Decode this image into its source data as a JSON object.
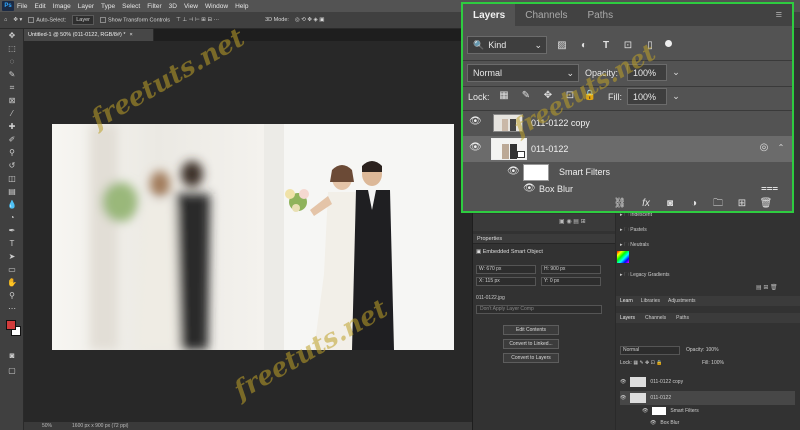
{
  "menubar": {
    "logo": "Ps",
    "items": [
      "File",
      "Edit",
      "Image",
      "Layer",
      "Type",
      "Select",
      "Filter",
      "3D",
      "View",
      "Window",
      "Help"
    ]
  },
  "options": {
    "auto_select": "Auto-Select:",
    "target": "Layer",
    "transform": "Show Transform Controls",
    "mode3d": "3D Mode:"
  },
  "document": {
    "tab_title": "Untitled-1 @ 50% (011-0122, RGB/8#) *",
    "zoom": "50%",
    "size": "1600 px x 900 px (72 ppi)"
  },
  "watermark": "freetuts.net",
  "layers_panel": {
    "tabs": [
      "Layers",
      "Channels",
      "Paths"
    ],
    "filter": "Kind",
    "blend": "Normal",
    "opacity_label": "Opacity:",
    "opacity": "100%",
    "lock_label": "Lock:",
    "fill_label": "Fill:",
    "fill": "100%",
    "layers": [
      {
        "name": "011-0122 copy"
      },
      {
        "name": "011-0122"
      }
    ],
    "smart_filters": "Smart Filters",
    "box_blur": "Box Blur"
  },
  "properties": {
    "title": "Properties",
    "type": "Embedded Smart Object",
    "w_label": "W:",
    "w": "670 px",
    "h_label": "H:",
    "h": "900 px",
    "x_label": "X:",
    "x": "115 px",
    "y_label": "Y:",
    "y": "0 px",
    "file": "011-0122.jpg",
    "layer_comp": "Don't Apply Layer Comp",
    "edit_contents": "Edit Contents",
    "convert_linked": "Convert to Linked...",
    "convert_layers": "Convert to Layers"
  },
  "swatch_groups": [
    "Iridescent",
    "Pastels",
    "Neutrals",
    "Legacy Gradients"
  ],
  "small_panel": {
    "tabs_top": [
      "Learn",
      "Libraries",
      "Adjustments"
    ],
    "tabs": [
      "Layers",
      "Channels",
      "Paths"
    ],
    "blend": "Normal",
    "opacity_label": "Opacity:",
    "opacity": "100%",
    "lock_label": "Lock:",
    "fill_label": "Fill:",
    "fill": "100%",
    "layers": [
      {
        "name": "011-0122 copy"
      },
      {
        "name": "011-0122"
      }
    ],
    "smart_filters": "Smart Filters",
    "box_blur": "Box Blur"
  },
  "colors": {
    "highlight_border": "#2ecc40",
    "foreground": "#d23b3b",
    "background": "#ffffff"
  }
}
